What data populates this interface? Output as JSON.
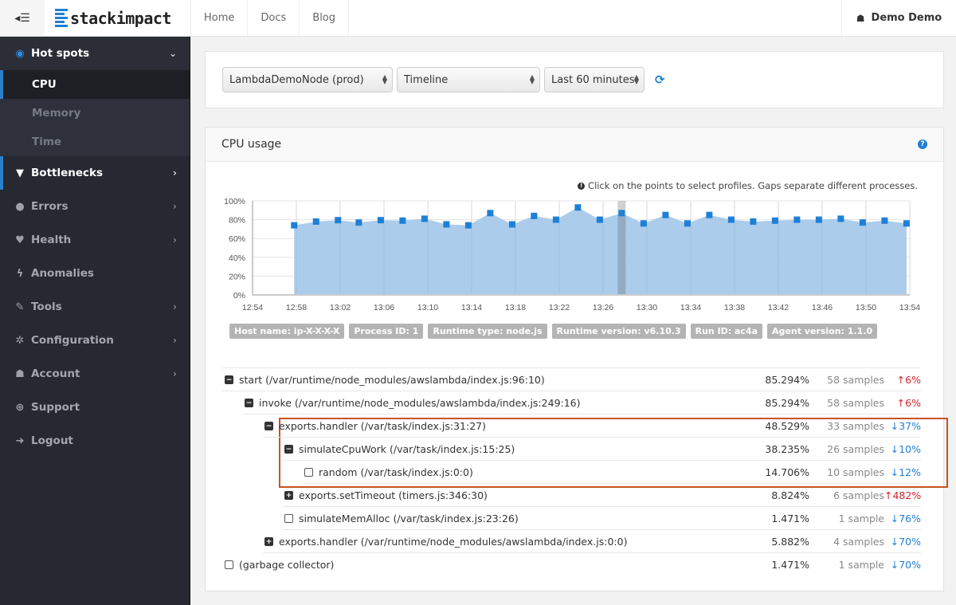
{
  "topbar": {
    "toggle_icon": "sidebar-toggle-icon",
    "brand": "stackimpact",
    "nav": [
      "Home",
      "Docs",
      "Blog"
    ],
    "user": "Demo Demo"
  },
  "sidebar": {
    "items": [
      {
        "label": "Hot spots",
        "icon": "target-icon",
        "glyph": "◉",
        "chevron": "⌄",
        "state": "open",
        "children": [
          {
            "label": "CPU",
            "active": true
          },
          {
            "label": "Memory",
            "active": false
          },
          {
            "label": "Time",
            "active": false
          }
        ]
      },
      {
        "label": "Bottlenecks",
        "icon": "filter-icon",
        "glyph": "▼",
        "chevron": "›",
        "state": "active-parent"
      },
      {
        "label": "Errors",
        "icon": "exclamation-icon",
        "glyph": "●",
        "chevron": "›"
      },
      {
        "label": "Health",
        "icon": "heartbeat-icon",
        "glyph": "♥",
        "chevron": "›"
      },
      {
        "label": "Anomalies",
        "icon": "bolt-icon",
        "glyph": "ϟ",
        "chevron": ""
      },
      {
        "label": "Tools",
        "icon": "wrench-icon",
        "glyph": "✎",
        "chevron": "›"
      },
      {
        "label": "Configuration",
        "icon": "gear-icon",
        "glyph": "✲",
        "chevron": "›"
      },
      {
        "label": "Account",
        "icon": "user-icon",
        "glyph": "☗",
        "chevron": "›"
      },
      {
        "label": "Support",
        "icon": "lifebuoy-icon",
        "glyph": "⊕",
        "chevron": ""
      },
      {
        "label": "Logout",
        "icon": "sign-out-icon",
        "glyph": "➜",
        "chevron": ""
      }
    ]
  },
  "filters": {
    "app": "LambdaDemoNode (prod)",
    "view": "Timeline",
    "range": "Last 60 minutes"
  },
  "cpu_panel": {
    "title": "CPU usage",
    "hint": "Click on the points to select profiles. Gaps separate different processes.",
    "tags": [
      "Host name: ip-X-X-X-X",
      "Process ID: 1",
      "Runtime type: node.js",
      "Runtime version: v6.10.3",
      "Run ID: ac4a",
      "Agent version: 1.1.0"
    ]
  },
  "chart_data": {
    "type": "area",
    "title": "CPU usage",
    "xlabel": "",
    "ylabel": "",
    "x_ticks": [
      "12:54",
      "12:58",
      "13:02",
      "13:06",
      "13:10",
      "13:14",
      "13:18",
      "13:22",
      "13:26",
      "13:30",
      "13:34",
      "13:38",
      "13:42",
      "13:46",
      "13:50",
      "13:54"
    ],
    "y_ticks": [
      "0%",
      "20%",
      "40%",
      "60%",
      "80%",
      "100%"
    ],
    "xlim_minutes_from_1254": [
      0,
      60
    ],
    "ylim": [
      0,
      100
    ],
    "grid": true,
    "selected_index": 15,
    "series": [
      {
        "name": "CPU usage",
        "color": "#1f7fd6",
        "fill": "#a7c9ea",
        "x_minutes_from_1254": [
          3.8,
          5.8,
          7.8,
          9.7,
          11.7,
          13.7,
          15.7,
          17.7,
          19.7,
          21.7,
          23.7,
          25.7,
          27.7,
          29.7,
          31.7,
          33.7,
          35.7,
          37.7,
          39.7,
          41.7,
          43.7,
          45.7,
          47.7,
          49.7,
          51.7,
          53.7,
          55.7,
          57.7,
          59.7
        ],
        "values": [
          74,
          78,
          79.5,
          77,
          79.5,
          79,
          81,
          75,
          74,
          87,
          75,
          84,
          80,
          93,
          80,
          87,
          76,
          85,
          76,
          85,
          80,
          78,
          79,
          80,
          80,
          81,
          77,
          79,
          76
        ]
      }
    ]
  },
  "profile_tree": [
    {
      "depth": 0,
      "node": "minus",
      "label": "start (/var/runtime/node_modules/awslambda/index.js:96:10)",
      "percent": "85.294%",
      "samples": "58 samples",
      "change": "6%",
      "dir": "up"
    },
    {
      "depth": 1,
      "node": "minus",
      "label": "invoke (/var/runtime/node_modules/awslambda/index.js:249:16)",
      "percent": "85.294%",
      "samples": "58 samples",
      "change": "6%",
      "dir": "up"
    },
    {
      "depth": 2,
      "node": "minus",
      "label": "exports.handler (/var/task/index.js:31:27)",
      "percent": "48.529%",
      "samples": "33 samples",
      "change": "37%",
      "dir": "down"
    },
    {
      "depth": 3,
      "node": "minus",
      "label": "simulateCpuWork (/var/task/index.js:15:25)",
      "percent": "38.235%",
      "samples": "26 samples",
      "change": "10%",
      "dir": "down"
    },
    {
      "depth": 4,
      "node": "leaf",
      "label": "random (/var/task/index.js:0:0)",
      "percent": "14.706%",
      "samples": "10 samples",
      "change": "12%",
      "dir": "down"
    },
    {
      "depth": 3,
      "node": "plus",
      "label": "exports.setTimeout (timers.js:346:30)",
      "percent": "8.824%",
      "samples": "6 samples",
      "change": "482%",
      "dir": "up"
    },
    {
      "depth": 3,
      "node": "leaf",
      "label": "simulateMemAlloc (/var/task/index.js:23:26)",
      "percent": "1.471%",
      "samples": "1 sample",
      "change": "76%",
      "dir": "down"
    },
    {
      "depth": 2,
      "node": "plus",
      "label": "exports.handler (/var/runtime/node_modules/awslambda/index.js:0:0)",
      "percent": "5.882%",
      "samples": "4 samples",
      "change": "70%",
      "dir": "down"
    },
    {
      "depth": 0,
      "node": "leaf",
      "label": "(garbage collector)",
      "percent": "1.471%",
      "samples": "1 sample",
      "change": "70%",
      "dir": "down"
    }
  ],
  "arrows": {
    "up": "↑",
    "down": "↓"
  }
}
